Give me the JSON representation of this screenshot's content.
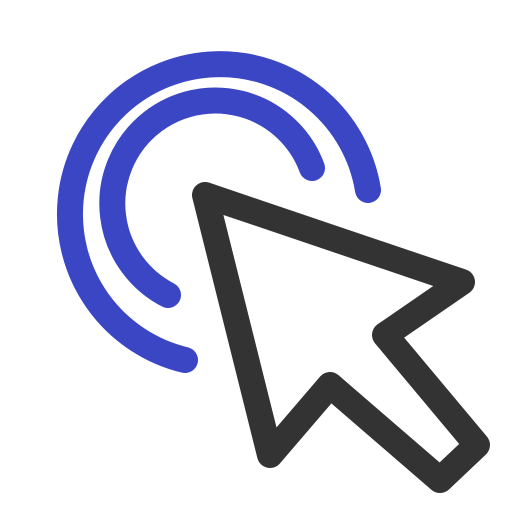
{
  "icon": {
    "name": "click-cursor-icon",
    "colors": {
      "arcs": "#3a46c4",
      "cursor": "#333333",
      "background": "#ffffff"
    }
  }
}
